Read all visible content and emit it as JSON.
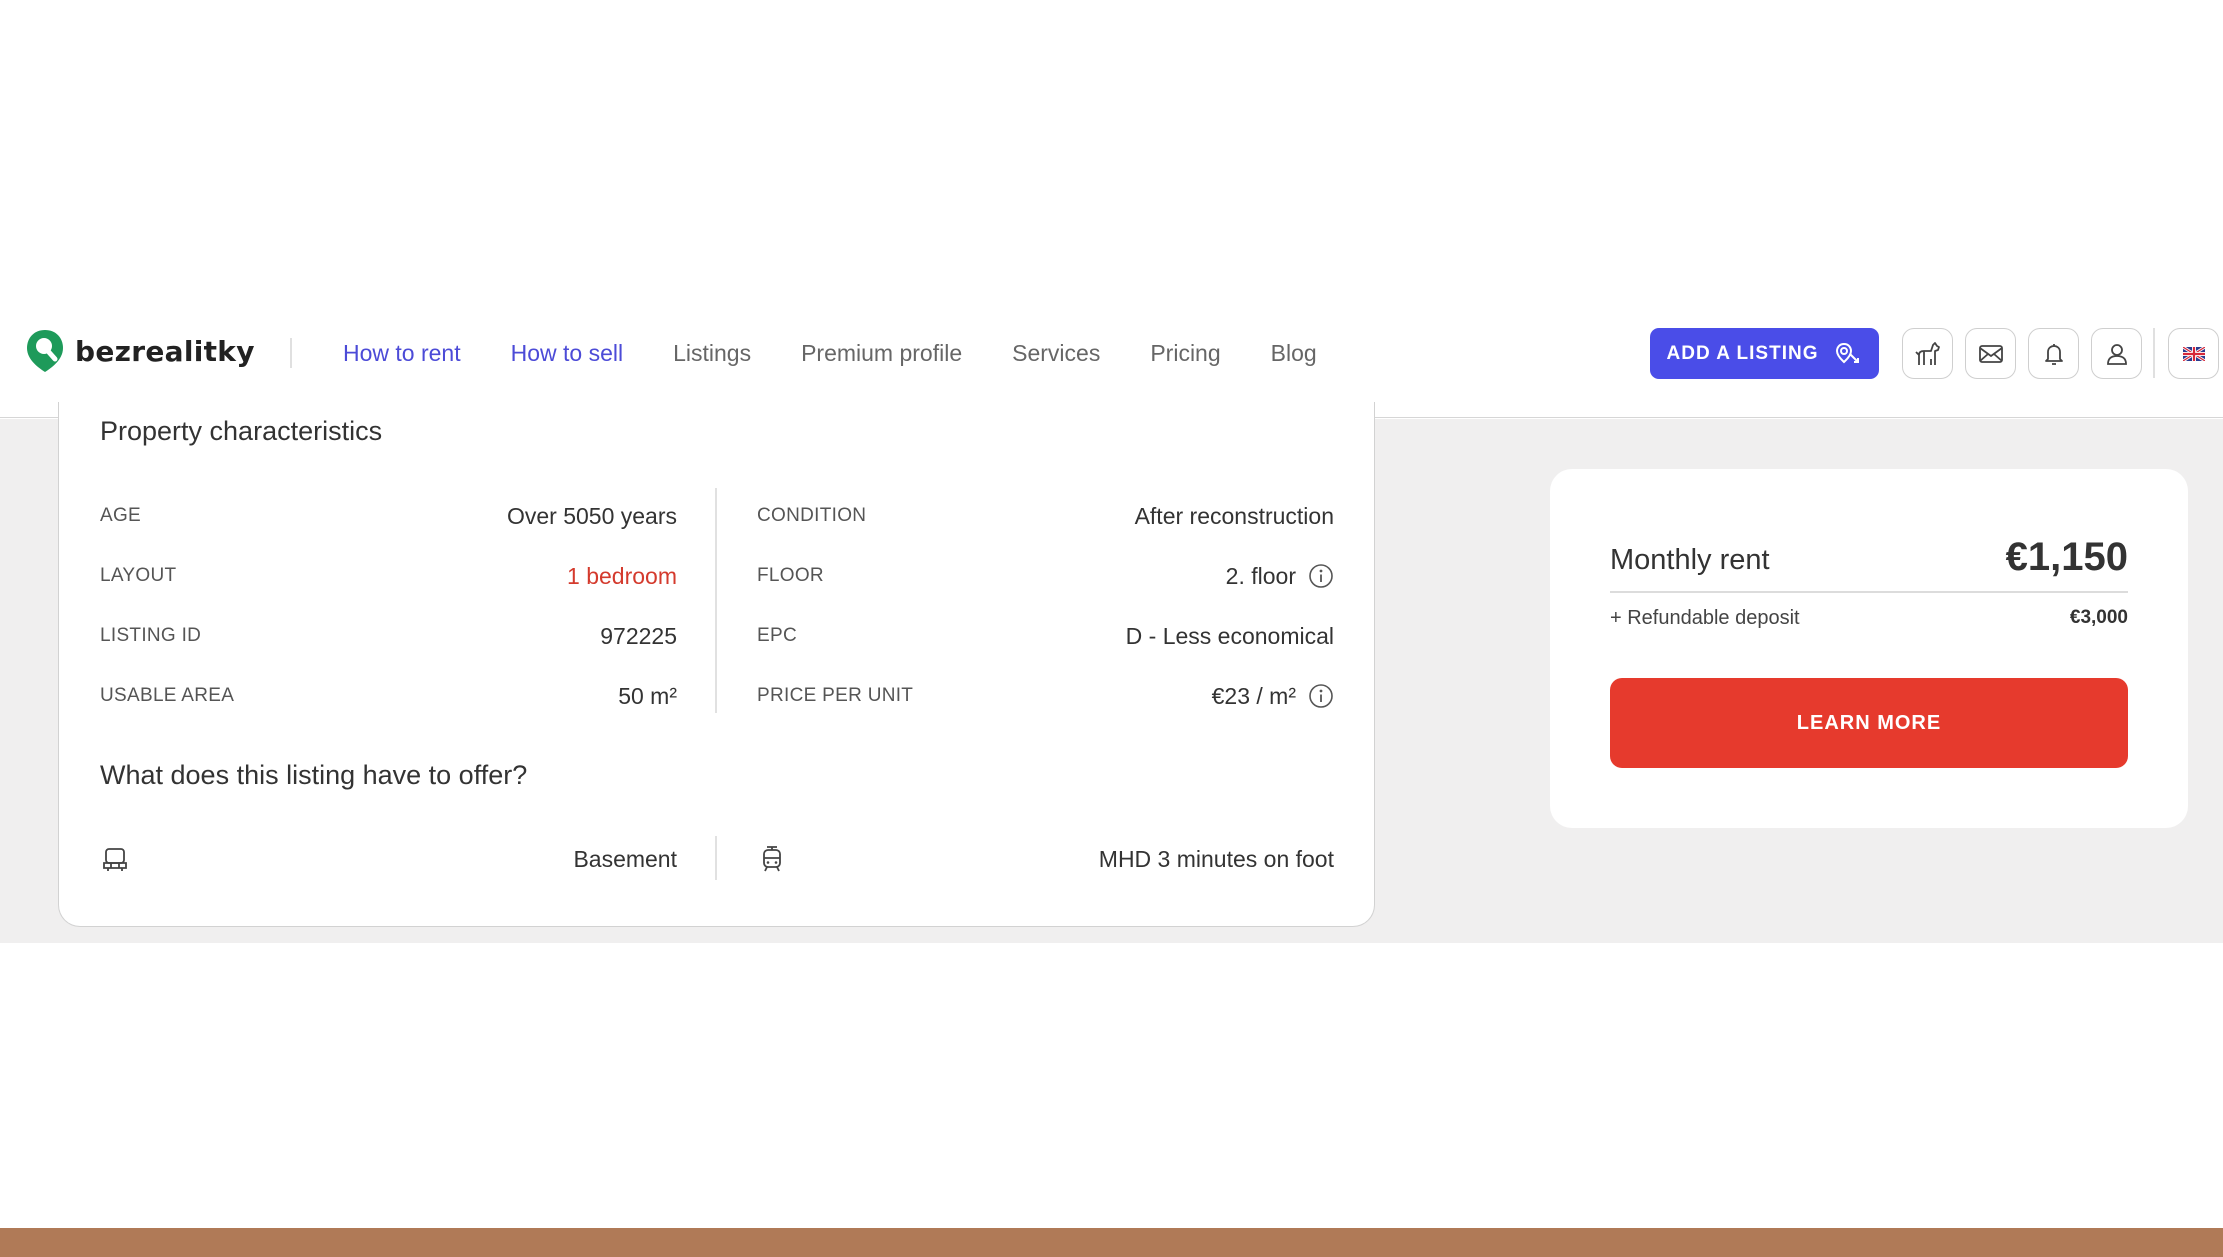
{
  "header": {
    "logo_text": "bezrealitky",
    "nav": [
      {
        "label": "How to rent",
        "active": true
      },
      {
        "label": "How to sell",
        "active": true
      },
      {
        "label": "Listings",
        "active": false
      },
      {
        "label": "Premium profile",
        "active": false
      },
      {
        "label": "Services",
        "active": false
      },
      {
        "label": "Pricing",
        "active": false
      },
      {
        "label": "Blog",
        "active": false
      }
    ],
    "add_listing_label": "ADD A LISTING",
    "icons": [
      "dog-icon",
      "mail-icon",
      "bell-icon",
      "user-icon",
      "uk-flag-icon"
    ]
  },
  "property": {
    "title": "Property characteristics",
    "left": [
      {
        "label": "AGE",
        "value": "Over 5050 years"
      },
      {
        "label": "LAYOUT",
        "value": "1 bedroom"
      },
      {
        "label": "LISTING ID",
        "value": "972225"
      },
      {
        "label": "USABLE AREA",
        "value": "50 m²"
      }
    ],
    "right": [
      {
        "label": "CONDITION",
        "value": "After reconstruction"
      },
      {
        "label": "FLOOR",
        "value": "2. floor"
      },
      {
        "label": "EPC",
        "value": "D - Less economical"
      },
      {
        "label": "PRICE PER UNIT",
        "value": "€23 / m²"
      }
    ]
  },
  "offer": {
    "title": "What does this listing have to offer?",
    "items": [
      {
        "icon": "basement-icon",
        "label": "Basement"
      },
      {
        "icon": "tram-icon",
        "label": "MHD 3 minutes on foot"
      }
    ]
  },
  "pricing": {
    "rent_label": "Monthly rent",
    "rent_value": "€1,150",
    "deposit_label": "+ Refundable deposit",
    "deposit_value": "€3,000",
    "cta_label": "LEARN MORE"
  },
  "colors": {
    "accent": "#4a4de8",
    "cta": "#e63a2d",
    "layout_value": "#d43a2d",
    "logo_green": "#1e9a5a"
  }
}
